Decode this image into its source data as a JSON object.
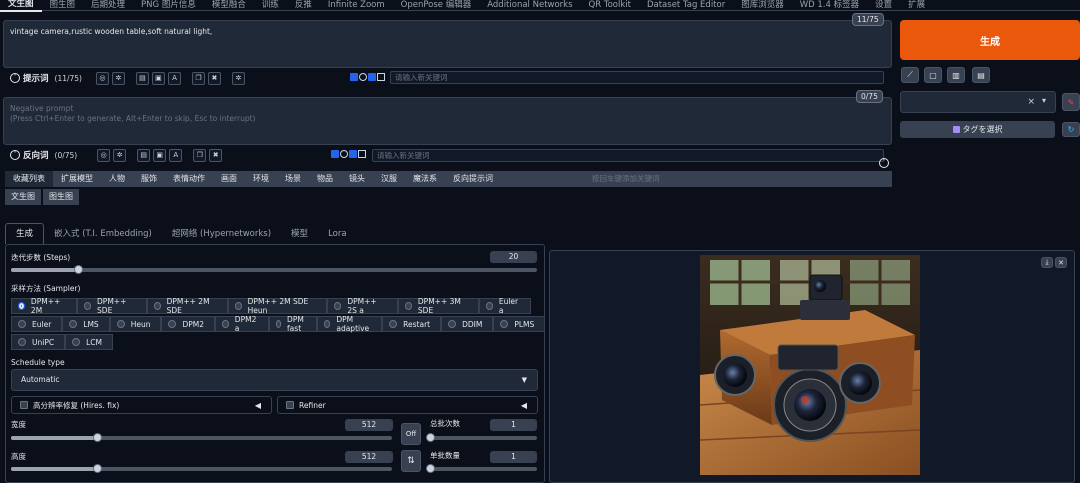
{
  "nav": {
    "tabs": [
      "文生图",
      "图生图",
      "后期处理",
      "PNG 图片信息",
      "模型融合",
      "训练",
      "反推",
      "Infinite Zoom",
      "OpenPose 编辑器",
      "Additional Networks",
      "QR Toolkit",
      "Dataset Tag Editor",
      "图库浏览器",
      "WD 1.4 标签器",
      "设置",
      "扩展"
    ],
    "active": 0
  },
  "prompt": {
    "text": "vintage camera,rustic wooden table,soft natural light,",
    "counter": "11/75",
    "label": "提示词",
    "count": "(11/75)",
    "keyword_placeholder": "请输入新关键词"
  },
  "negative": {
    "placeholder_line1": "Negative prompt",
    "placeholder_line2": "(Press Ctrl+Enter to generate, Alt+Enter to skip, Esc to interrupt)",
    "counter": "0/75",
    "label": "反向词",
    "count": "(0/75)",
    "keyword_placeholder": "请输入新关键词"
  },
  "categories": {
    "items": [
      "收藏列表",
      "扩展模型",
      "人物",
      "服饰",
      "表情动作",
      "画面",
      "环境",
      "场景",
      "物品",
      "镜头",
      "汉服",
      "魔法系",
      "反向提示词"
    ],
    "hint": "按回车键添加关键词",
    "sub": [
      "文生图",
      "图生图"
    ]
  },
  "right": {
    "generate": "生成",
    "tag_select": "タグを選択",
    "style_x": "×",
    "style_caret": "▾"
  },
  "subtabs": [
    "生成",
    "嵌入式 (T.I. Embedding)",
    "超网络 (Hypernetworks)",
    "模型",
    "Lora"
  ],
  "params": {
    "steps_label": "迭代步数 (Steps)",
    "steps": 20,
    "steps_max": 150,
    "sampler_label": "采样方法 (Sampler)",
    "sampler_rows": [
      [
        "DPM++ 2M",
        "DPM++ SDE",
        "DPM++ 2M SDE",
        "DPM++ 2M SDE Heun",
        "DPM++ 2S a",
        "DPM++ 3M SDE",
        "Euler a"
      ],
      [
        "Euler",
        "LMS",
        "Heun",
        "DPM2",
        "DPM2 a",
        "DPM fast",
        "DPM adaptive",
        "Restart",
        "DDIM",
        "PLMS"
      ],
      [
        "UniPC",
        "LCM"
      ]
    ],
    "sampler_selected": "DPM++ 2M",
    "schedule_label": "Schedule type",
    "schedule_value": "Automatic",
    "hires_label": "高分辨率修复 (Hires. fix)",
    "refiner_label": "Refiner",
    "width_label": "宽度",
    "width": 512,
    "height_label": "高度",
    "height": 512,
    "dim_max": 2048,
    "off_label": "Off",
    "swap_icon": "⇅",
    "batch_count_label": "总批次数",
    "batch_count": 1,
    "batch_size_label": "单批数量",
    "batch_size": 1,
    "batch_max": 100,
    "arrow": "◀"
  },
  "colors": {
    "accent": "#ea580c",
    "bg": "#0b0f19",
    "panel": "#1f2937"
  }
}
